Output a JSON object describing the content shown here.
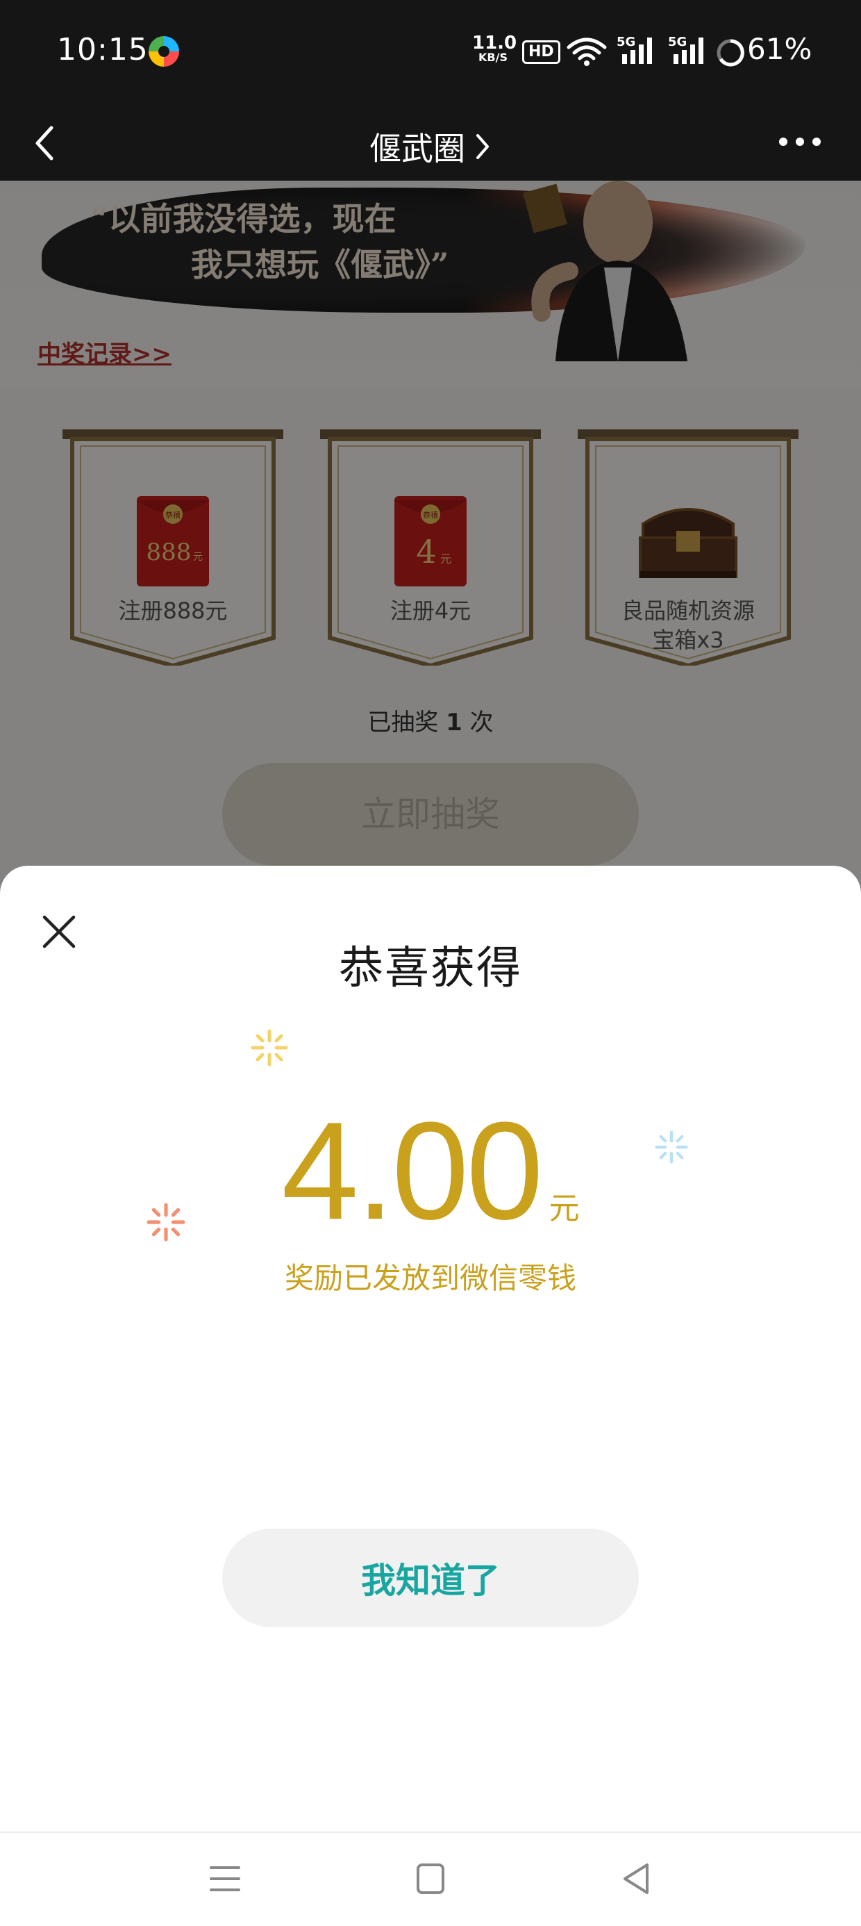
{
  "status_bar": {
    "time": "10:15",
    "net_speed_value": "11.0",
    "net_speed_unit": "KB/S",
    "hd_badge": "HD",
    "sim1": "5G",
    "sim2": "5G",
    "battery_percent": "61%"
  },
  "nav": {
    "title": "偃武圈",
    "back_icon": "chevron-left-icon",
    "more_icon": "more-horizontal-icon"
  },
  "banner": {
    "quote_line1": "“以前我没得选，现在",
    "quote_line2": "我只想玩《偃武》”",
    "record_link": "中奖记录>>"
  },
  "prizes": [
    {
      "label": "注册888元",
      "icon_text": "888",
      "icon_unit": "元",
      "icon_seal": "恭禧"
    },
    {
      "label": "注册4元",
      "icon_text": "4",
      "icon_unit": "元",
      "icon_seal": "恭禧"
    },
    {
      "label_line1": "良品随机资源",
      "label_line2": "宝箱x3",
      "icon": "treasure-chest-icon"
    }
  ],
  "draw": {
    "count_prefix": "已抽奖",
    "count_value": "1",
    "count_suffix": "次",
    "button_label": "立即抽奖"
  },
  "dialog": {
    "title": "恭喜获得",
    "amount": "4.00",
    "unit": "元",
    "note": "奖励已发放到微信零钱",
    "confirm_label": "我知道了",
    "close_icon": "close-icon"
  },
  "colors": {
    "gold": "#c9a11c",
    "teal": "#1aa6a0",
    "dark_bar": "#151515",
    "sparkle_yellow": "#f4d46a",
    "sparkle_blue": "#b9e1f5",
    "sparkle_orange": "#f2906f"
  }
}
